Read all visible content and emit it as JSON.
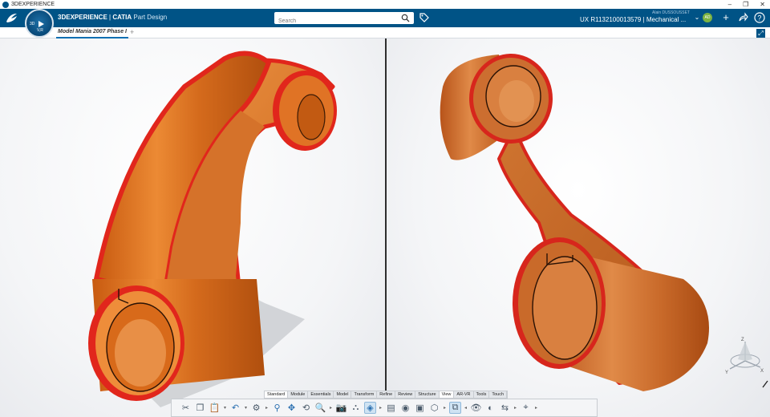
{
  "window": {
    "title": "3DEXPERIENCE",
    "controls": [
      "–",
      "❐",
      "✕"
    ]
  },
  "header": {
    "brand_bold": "3DEXPERIENCE",
    "brand_sep": " | ",
    "brand_product": "CATIA",
    "brand_app": " Part Design",
    "search_placeholder": "Search",
    "user_name": "Alain DUSSOUSSET",
    "context": "UX R1132100013579 | Mechanical ...",
    "avatar_initials": "AD",
    "accent": "#005386"
  },
  "compass": {
    "top_label": "3D",
    "bottom_label": "V,R"
  },
  "tab": {
    "label": "Model Mania 2007 Phase I",
    "add": "+"
  },
  "section_tabs": [
    "Standard",
    "Module",
    "Essentials",
    "Model",
    "Transform",
    "Refine",
    "Review",
    "Structure",
    "View",
    "AR-VR",
    "Tools",
    "Touch"
  ],
  "active_section": "View",
  "triad_axes": {
    "x": "X",
    "y": "Y",
    "z": "Z"
  },
  "model_colors": {
    "body": "#d96a1c",
    "edge": "#e1261c"
  }
}
